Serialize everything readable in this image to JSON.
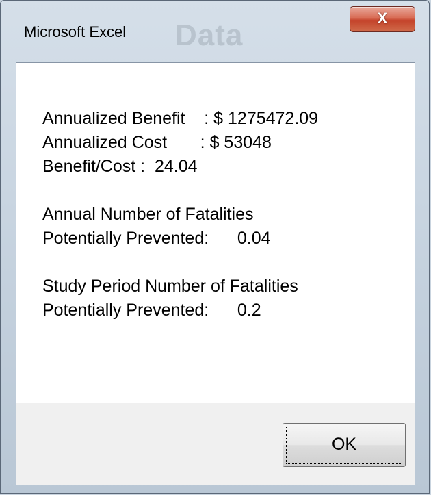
{
  "dialog": {
    "title": "Microsoft Excel",
    "close_glyph": "X",
    "background_text": "Data",
    "lines": {
      "benefit": "Annualized Benefit    : $ 1275472.09",
      "cost": "Annualized Cost       : $ 53048",
      "ratio": "Benefit/Cost :  24.04",
      "annual_heading": "Annual Number of Fatalities",
      "annual_value": "Potentially Prevented:      0.04",
      "study_heading": "Study Period Number of Fatalities",
      "study_value": "Potentially Prevented:      0.2"
    },
    "ok_label": "OK"
  },
  "colors": {
    "frame": "#c3d0dd",
    "close_button": "#c4432a",
    "client_background": "#ffffff",
    "button_bar": "#f0f0f0"
  }
}
